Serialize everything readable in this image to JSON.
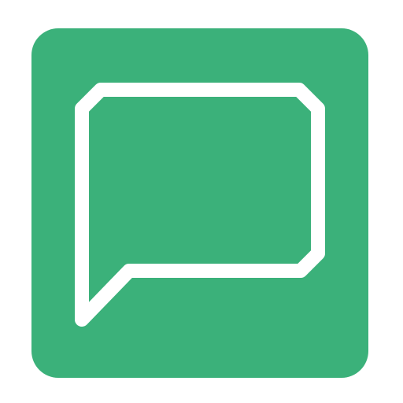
{
  "icon": {
    "name": "chat-bubble-icon",
    "colors": {
      "background": "#3bb17a",
      "bubble_outline": "#ffffff",
      "page": "#ffffff"
    }
  }
}
